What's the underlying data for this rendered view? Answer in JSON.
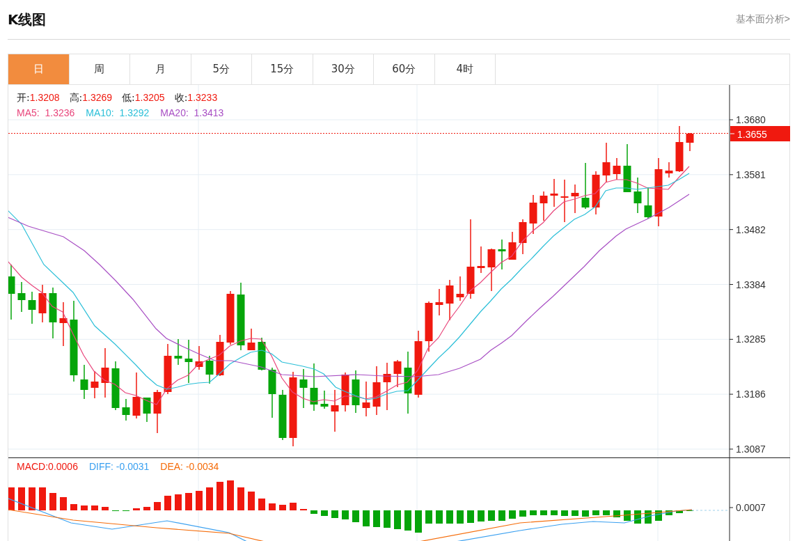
{
  "header": {
    "title": "K线图",
    "link": "基本面分析>"
  },
  "tabs": [
    {
      "label": "日",
      "selected": true
    },
    {
      "label": "周",
      "selected": false
    },
    {
      "label": "月",
      "selected": false
    },
    {
      "label": "5分",
      "selected": false
    },
    {
      "label": "15分",
      "selected": false
    },
    {
      "label": "30分",
      "selected": false
    },
    {
      "label": "60分",
      "selected": false
    },
    {
      "label": "4时",
      "selected": false
    }
  ],
  "price_chart": {
    "ohlc": [
      {
        "label": "开:",
        "value": "1.3208"
      },
      {
        "label": "高:",
        "value": "1.3269"
      },
      {
        "label": "低:",
        "value": "1.3205"
      },
      {
        "label": "收:",
        "value": "1.3233"
      }
    ],
    "moving_averages": [
      {
        "label": "MA5:  1.3236",
        "color": "#e8467c"
      },
      {
        "label": "MA10:  1.3292",
        "color": "#2bbfd8"
      },
      {
        "label": "MA20:  1.3413",
        "color": "#a84fc4"
      }
    ],
    "y_ticks": [
      "1.3680",
      "1.3581",
      "1.3482",
      "1.3384",
      "1.3285",
      "1.3186",
      "1.3087"
    ],
    "current_price": "1.3655"
  },
  "macd_chart": {
    "legend": [
      {
        "label": "MACD:0.0006",
        "color": "#f0190f"
      },
      {
        "label": "DIFF: -0.0031",
        "color": "#3aa0f0"
      },
      {
        "label": "DEA: -0.0034",
        "color": "#f56c0a"
      }
    ],
    "y_tick": "0.0007"
  }
}
